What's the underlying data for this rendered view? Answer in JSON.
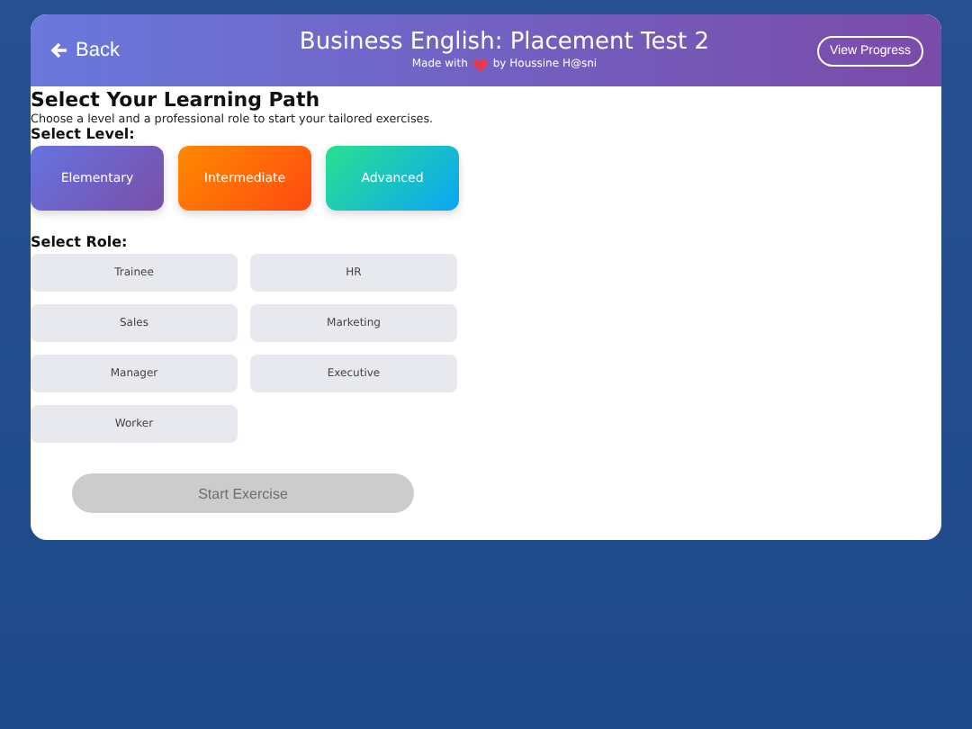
{
  "header": {
    "back": "Back",
    "title": "Business English: Placement Test 2",
    "credit_before": "Made with",
    "credit_after": "by Houssine H@sni",
    "progress_button": "View Progress"
  },
  "heading": "Select Your Learning Path",
  "intro": "Choose a level and a professional role to start your tailored exercises.",
  "level_label": "Select Level:",
  "levels": [
    {
      "label": "Elementary",
      "kind": "purple"
    },
    {
      "label": "Intermediate",
      "kind": "orange"
    },
    {
      "label": "Advanced",
      "kind": "teal"
    }
  ],
  "role_label": "Select Role:",
  "roles": [
    {
      "label": "Trainee",
      "selected": false
    },
    {
      "label": "HR",
      "selected": false
    },
    {
      "label": "Sales",
      "selected": false
    },
    {
      "label": "Marketing",
      "selected": false
    },
    {
      "label": "Manager",
      "selected": false
    },
    {
      "label": "Executive",
      "selected": false
    },
    {
      "label": "Worker",
      "selected": false
    }
  ],
  "start": {
    "label": "Start Exercise",
    "disabled": true
  }
}
